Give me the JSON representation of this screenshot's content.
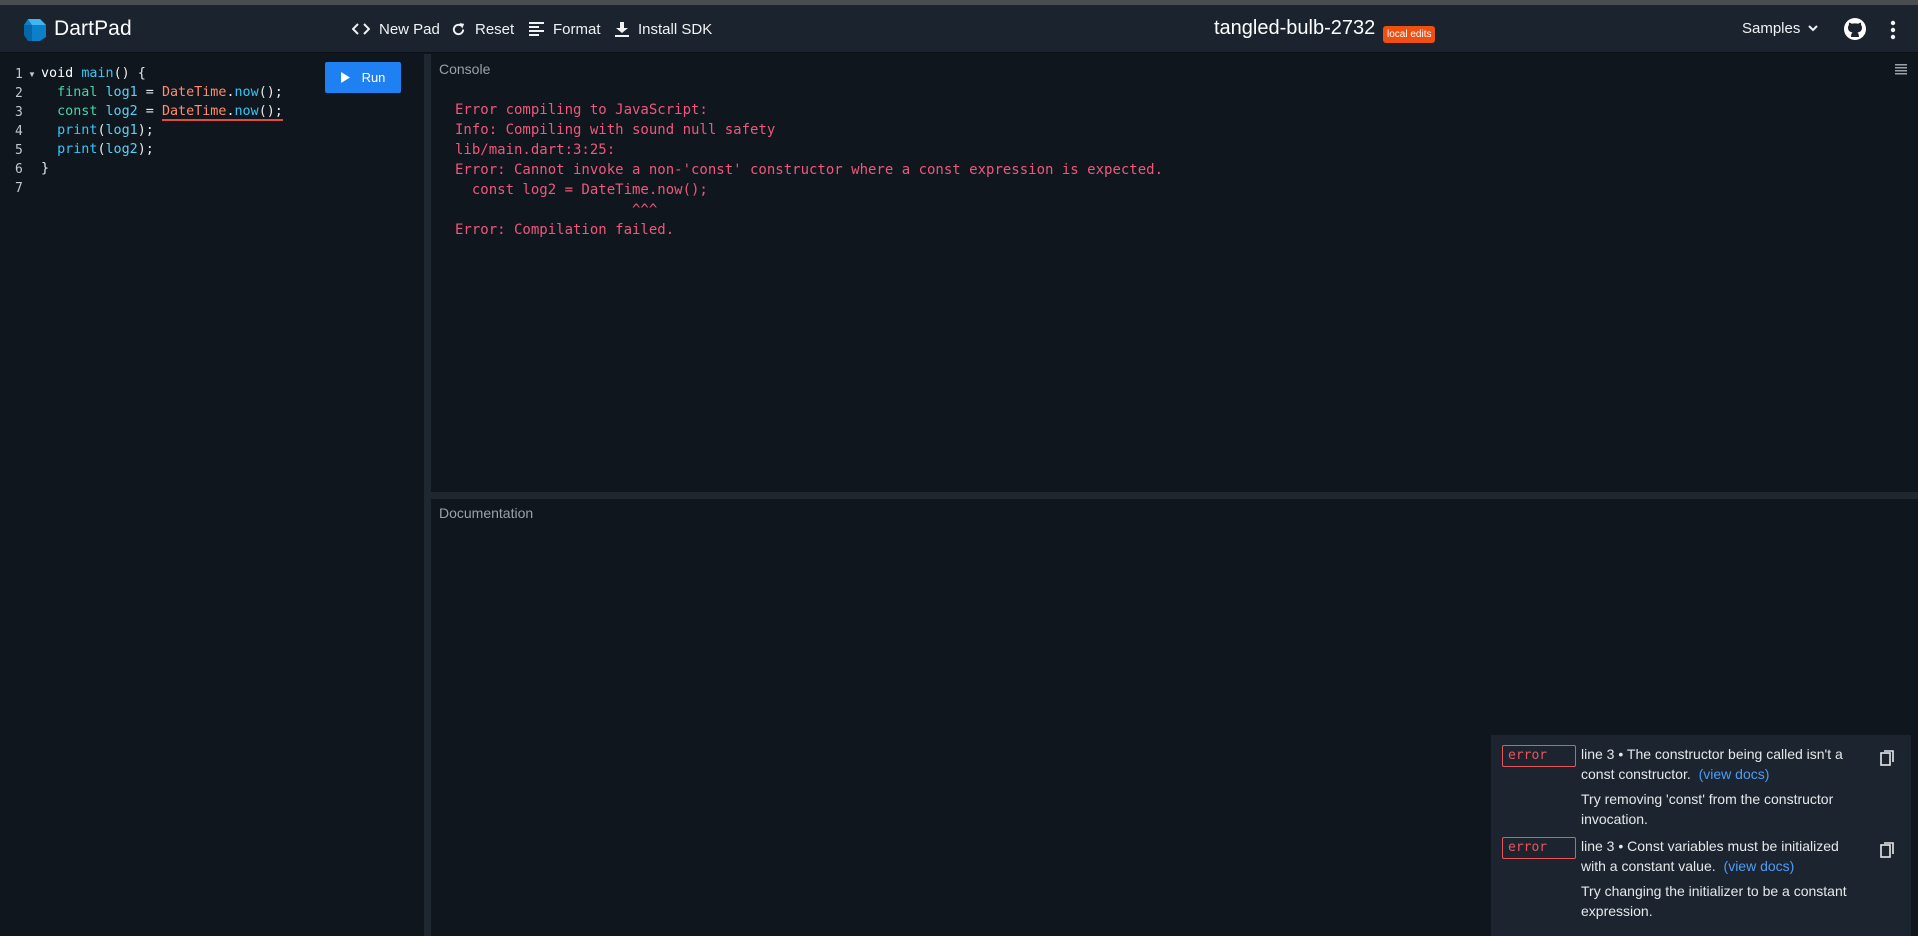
{
  "header": {
    "app_name": "DartPad",
    "toolbar": {
      "new_pad": "New Pad",
      "reset": "Reset",
      "format": "Format",
      "install_sdk": "Install SDK"
    },
    "pad_title": "tangled-bulb-2732",
    "badge": "local edits",
    "samples": "Samples"
  },
  "editor": {
    "run_label": "Run",
    "line_numbers": [
      "1",
      "2",
      "3",
      "4",
      "5",
      "6",
      "7"
    ],
    "code": {
      "l1_kw": "void",
      "l1_fn": "main",
      "l1_rest": "() {",
      "l2_kw": "final",
      "l2_var": "log1",
      "l2_eq": " = ",
      "l2_cls": "DateTime",
      "l2_dot": ".",
      "l2_fn": "now",
      "l2_end": "();",
      "l3_kw": "const",
      "l3_var": "log2",
      "l3_eq": " = ",
      "l3_cls": "DateTime",
      "l3_dot": ".",
      "l3_fn": "now",
      "l3_end": "();",
      "l4_fn": "print",
      "l4_var": "log1",
      "l4_end": ");",
      "l5_fn": "print",
      "l5_var": "log2",
      "l5_end": ");",
      "l6": "}"
    }
  },
  "console": {
    "label": "Console",
    "output": "Error compiling to JavaScript:\nInfo: Compiling with sound null safety\nlib/main.dart:3:25:\nError: Cannot invoke a non-'const' constructor where a const expression is expected.\n  const log2 = DateTime.now();\n                     ^^^\nError: Compilation failed."
  },
  "documentation": {
    "label": "Documentation"
  },
  "problems": [
    {
      "tag": "error",
      "message": "line 3 • The constructor being called isn't a const constructor.",
      "link": "(view docs)",
      "hint": "Try removing 'const' from the constructor invocation."
    },
    {
      "tag": "error",
      "message": "line 3 • Const variables must be initialized with a constant value.",
      "link": "(view docs)",
      "hint": "Try changing the initializer to be a constant expression."
    }
  ],
  "colors": {
    "accent": "#1f80f3",
    "badge": "#ef4f10",
    "error": "#f0577a",
    "link": "#4a9df8"
  }
}
